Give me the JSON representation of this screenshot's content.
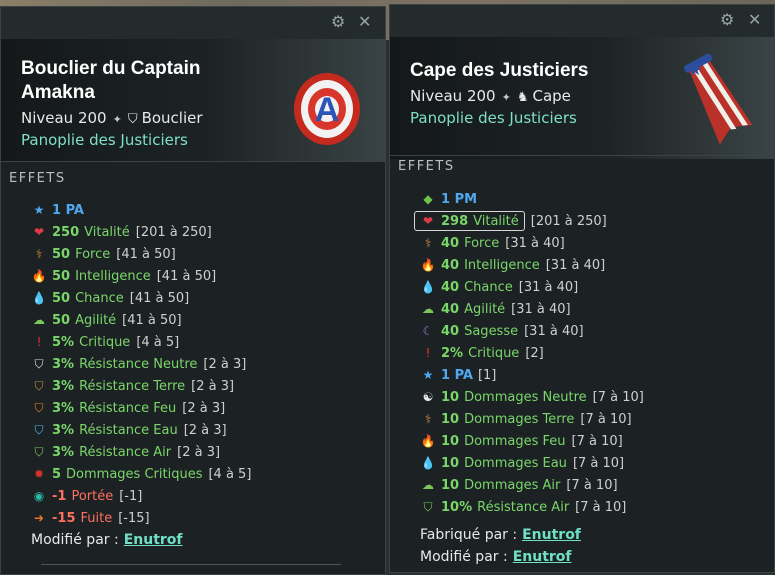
{
  "left": {
    "title": "Bouclier du Captain Amakna",
    "level": "Niveau 200",
    "type": "Bouclier",
    "set": "Panoplie des Justiciers",
    "effects_label": "EFFETS",
    "effects": [
      {
        "icon": "star-icon",
        "value": "1 PA",
        "name": "",
        "range": "",
        "color": "blue"
      },
      {
        "icon": "heart-icon",
        "value": "250",
        "name": "Vitalité",
        "range": "[201 à 250]",
        "color": "green"
      },
      {
        "icon": "strength-icon",
        "value": "50",
        "name": "Force",
        "range": "[41 à 50]",
        "color": "green"
      },
      {
        "icon": "fire-icon",
        "value": "50",
        "name": "Intelligence",
        "range": "[41 à 50]",
        "color": "green"
      },
      {
        "icon": "water-drop-icon",
        "value": "50",
        "name": "Chance",
        "range": "[41 à 50]",
        "color": "green"
      },
      {
        "icon": "air-cloud-icon",
        "value": "50",
        "name": "Agilité",
        "range": "[41 à 50]",
        "color": "green"
      },
      {
        "icon": "critical-icon",
        "value": "5%",
        "name": "Critique",
        "range": "[4 à 5]",
        "color": "green"
      },
      {
        "icon": "shield-neutral-icon",
        "value": "3%",
        "name": "Résistance Neutre",
        "range": "[2 à 3]",
        "color": "green"
      },
      {
        "icon": "shield-earth-icon",
        "value": "3%",
        "name": "Résistance Terre",
        "range": "[2 à 3]",
        "color": "green"
      },
      {
        "icon": "shield-fire-icon",
        "value": "3%",
        "name": "Résistance Feu",
        "range": "[2 à 3]",
        "color": "green"
      },
      {
        "icon": "shield-water-icon",
        "value": "3%",
        "name": "Résistance Eau",
        "range": "[2 à 3]",
        "color": "green"
      },
      {
        "icon": "shield-air-icon",
        "value": "3%",
        "name": "Résistance Air",
        "range": "[2 à 3]",
        "color": "green"
      },
      {
        "icon": "critical-damage-icon",
        "value": "5",
        "name": "Dommages Critiques",
        "range": "[4 à 5]",
        "color": "green"
      },
      {
        "icon": "eye-icon",
        "value": "-1",
        "name": "Portée",
        "range": "[-1]",
        "color": "red"
      },
      {
        "icon": "flee-icon",
        "value": "-15",
        "name": "Fuite",
        "range": "[-15]",
        "color": "red"
      }
    ],
    "modified_label": "Modifié par :",
    "modified_by": "Enutrof"
  },
  "right": {
    "title": "Cape des Justiciers",
    "level": "Niveau 200",
    "type": "Cape",
    "set": "Panoplie des Justiciers",
    "effects_label": "EFFETS",
    "effects": [
      {
        "icon": "pm-diamond-icon",
        "value": "1 PM",
        "name": "",
        "range": "",
        "color": "blue"
      },
      {
        "icon": "heart-icon",
        "value": "298",
        "name": "Vitalité",
        "range": "[201 à 250]",
        "color": "green",
        "boxed": true
      },
      {
        "icon": "strength-icon",
        "value": "40",
        "name": "Force",
        "range": "[31 à 40]",
        "color": "green"
      },
      {
        "icon": "fire-icon",
        "value": "40",
        "name": "Intelligence",
        "range": "[31 à 40]",
        "color": "green"
      },
      {
        "icon": "water-drop-icon",
        "value": "40",
        "name": "Chance",
        "range": "[31 à 40]",
        "color": "green"
      },
      {
        "icon": "air-cloud-icon",
        "value": "40",
        "name": "Agilité",
        "range": "[31 à 40]",
        "color": "green"
      },
      {
        "icon": "moon-icon",
        "value": "40",
        "name": "Sagesse",
        "range": "[31 à 40]",
        "color": "green"
      },
      {
        "icon": "critical-icon",
        "value": "2%",
        "name": "Critique",
        "range": "[2]",
        "color": "green"
      },
      {
        "icon": "star-icon",
        "value": "1 PA",
        "name": "",
        "range": "[1]",
        "color": "blue"
      },
      {
        "icon": "yin-yang-icon",
        "value": "10",
        "name": "Dommages Neutre",
        "range": "[7 à 10]",
        "color": "green"
      },
      {
        "icon": "strength-icon",
        "value": "10",
        "name": "Dommages Terre",
        "range": "[7 à 10]",
        "color": "green"
      },
      {
        "icon": "fire-icon",
        "value": "10",
        "name": "Dommages Feu",
        "range": "[7 à 10]",
        "color": "green"
      },
      {
        "icon": "water-drop-icon",
        "value": "10",
        "name": "Dommages Eau",
        "range": "[7 à 10]",
        "color": "green"
      },
      {
        "icon": "air-cloud-icon",
        "value": "10",
        "name": "Dommages Air",
        "range": "[7 à 10]",
        "color": "green"
      },
      {
        "icon": "shield-air-icon",
        "value": "10%",
        "name": "Résistance Air",
        "range": "[7 à 10]",
        "color": "green"
      }
    ],
    "crafted_label": "Fabriqué par :",
    "crafted_by": "Enutrof",
    "modified_label": "Modifié par :",
    "modified_by": "Enutrof"
  },
  "colors": {
    "green": "#7bd66a",
    "blue": "#4fa8f0",
    "red": "#ff6e5e",
    "set": "#7fe0c9"
  }
}
